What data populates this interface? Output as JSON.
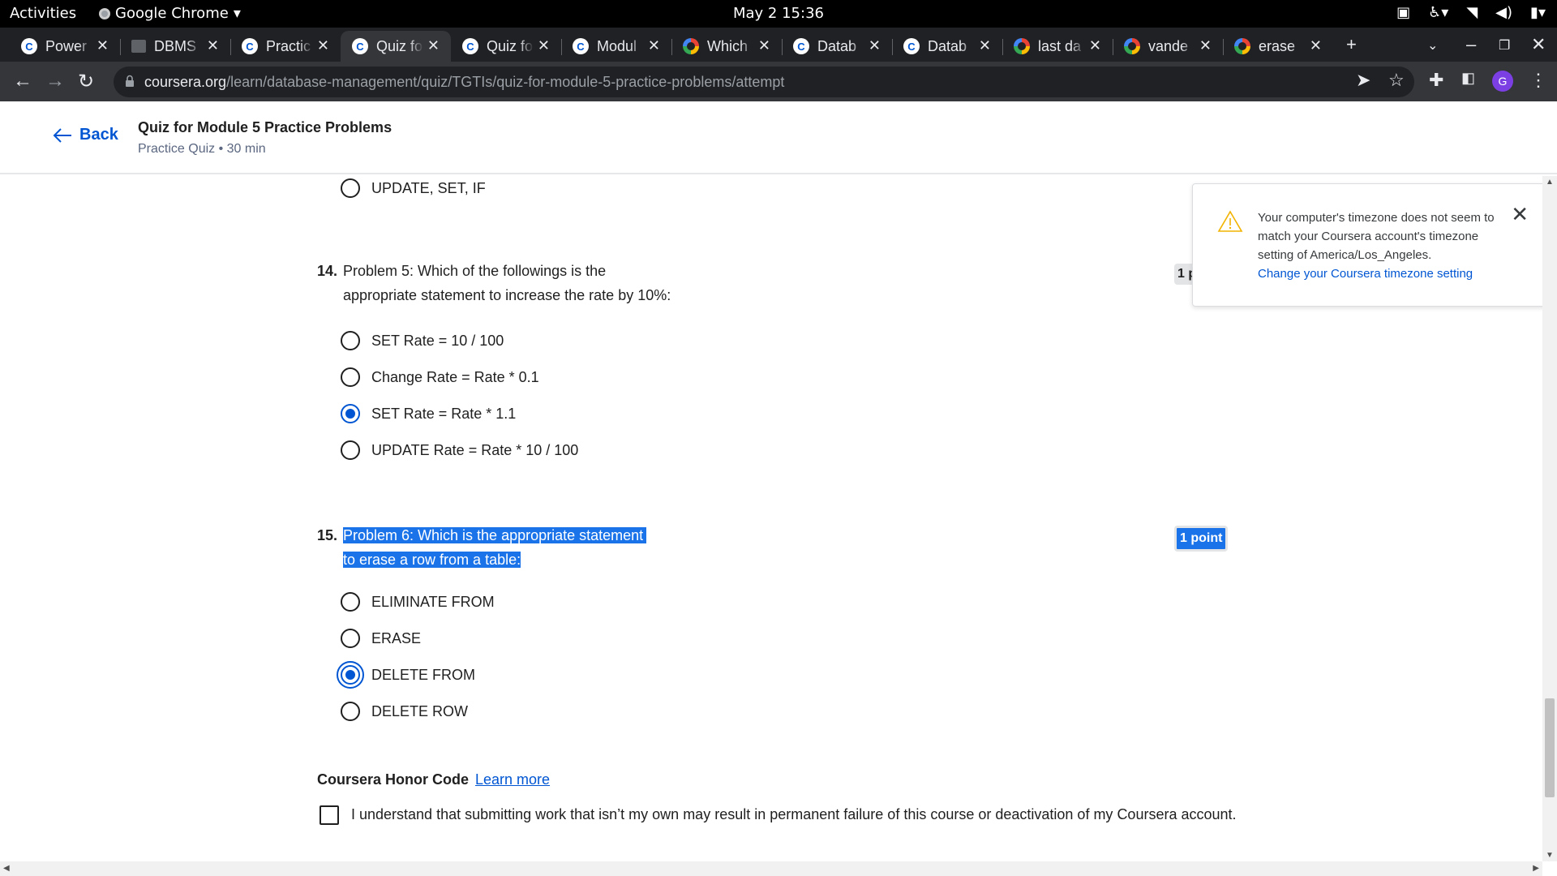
{
  "os": {
    "activities": "Activities",
    "app_name": "Google Chrome",
    "clock": "May 2  15:36"
  },
  "tabs": [
    {
      "label": "Power",
      "favicon": "coursera-icon"
    },
    {
      "label": "DBMS",
      "favicon": "document-icon"
    },
    {
      "label": "Practic",
      "favicon": "coursera-icon"
    },
    {
      "label": "Quiz fo",
      "favicon": "coursera-icon",
      "active": true
    },
    {
      "label": "Quiz fo",
      "favicon": "coursera-icon"
    },
    {
      "label": "Modul",
      "favicon": "coursera-icon"
    },
    {
      "label": "Which",
      "favicon": "google-icon"
    },
    {
      "label": "Datab",
      "favicon": "coursera-icon"
    },
    {
      "label": "Datab",
      "favicon": "coursera-icon"
    },
    {
      "label": "last da",
      "favicon": "google-icon"
    },
    {
      "label": "vande",
      "favicon": "google-icon"
    },
    {
      "label": "erase",
      "favicon": "google-icon"
    }
  ],
  "address": {
    "host": "coursera.org",
    "path": "/learn/database-management/quiz/TGTIs/quiz-for-module-5-practice-problems/attempt"
  },
  "profile_initial": "G",
  "header": {
    "back_label": "Back",
    "title": "Quiz for Module 5 Practice Problems",
    "subtitle": "Practice Quiz • 30 min"
  },
  "prev_question": {
    "option": "UPDATE, SET, IF"
  },
  "questions": [
    {
      "number": "14.",
      "text_line1": "Problem 5: Which of the followings is the",
      "text_line2": "appropriate statement to increase the rate by 10%:",
      "points": "1 p",
      "options": [
        "SET Rate = 10 / 100",
        "Change Rate = Rate * 0.1",
        "SET Rate = Rate * 1.1",
        "UPDATE Rate = Rate * 10 / 100"
      ],
      "selected_index": 2
    },
    {
      "number": "15.",
      "text_line1": "Problem 6: Which is the appropriate statement",
      "text_line2": "to erase a row from a table:",
      "points": "1 point",
      "options": [
        "ELIMINATE FROM",
        "ERASE",
        "DELETE FROM",
        "DELETE ROW"
      ],
      "selected_index": 2
    }
  ],
  "honor": {
    "title": "Coursera Honor Code",
    "learn_more": "Learn more",
    "statement": "I understand that submitting work that isn’t my own may result in permanent failure of this course or deactivation of my Coursera account.",
    "checked": false
  },
  "timezone_popup": {
    "message": "Your computer's timezone does not seem to match your Coursera account's timezone setting of America/Los_Angeles.",
    "link": "Change your Coursera timezone setting"
  },
  "colors": {
    "accent": "#0056d2",
    "selection": "#1a73e8",
    "chrome_dark": "#202124"
  }
}
